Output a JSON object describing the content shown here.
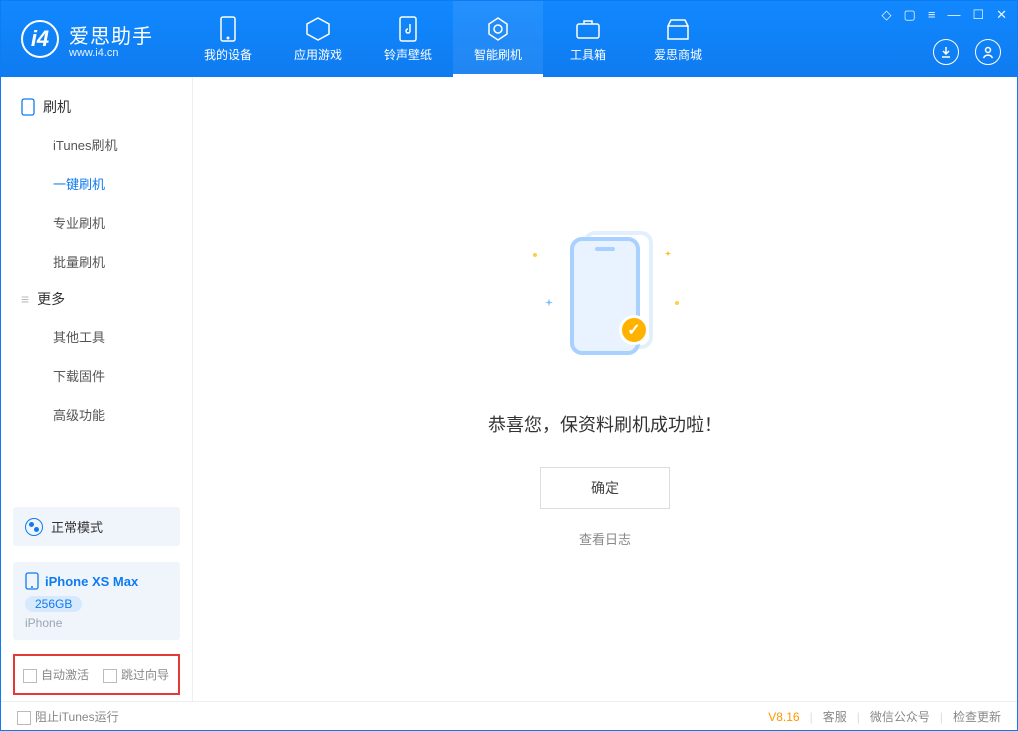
{
  "header": {
    "app_name": "爱思助手",
    "app_url": "www.i4.cn",
    "tabs": [
      {
        "label": "我的设备",
        "icon": "device-icon"
      },
      {
        "label": "应用游戏",
        "icon": "app-icon"
      },
      {
        "label": "铃声壁纸",
        "icon": "music-icon"
      },
      {
        "label": "智能刷机",
        "icon": "flash-icon"
      },
      {
        "label": "工具箱",
        "icon": "toolbox-icon"
      },
      {
        "label": "爱思商城",
        "icon": "store-icon"
      }
    ]
  },
  "sidebar": {
    "section1_label": "刷机",
    "items1": [
      "iTunes刷机",
      "一键刷机",
      "专业刷机",
      "批量刷机"
    ],
    "section2_label": "更多",
    "items2": [
      "其他工具",
      "下载固件",
      "高级功能"
    ],
    "mode_label": "正常模式",
    "device": {
      "name": "iPhone XS Max",
      "storage": "256GB",
      "type": "iPhone"
    },
    "checkbox1": "自动激活",
    "checkbox2": "跳过向导"
  },
  "main": {
    "success_text": "恭喜您，保资料刷机成功啦！",
    "ok_button": "确定",
    "log_link": "查看日志"
  },
  "footer": {
    "block_itunes": "阻止iTunes运行",
    "version": "V8.16",
    "links": [
      "客服",
      "微信公众号",
      "检查更新"
    ]
  }
}
